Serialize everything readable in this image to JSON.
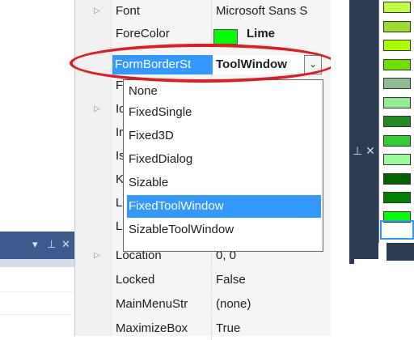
{
  "left_panel": {
    "titlebar_controls": [
      "▾",
      "ᛜ",
      "✕"
    ]
  },
  "properties": [
    {
      "name": "Font",
      "value": "Microsoft Sans S",
      "expandable": true
    },
    {
      "name": "ForeColor",
      "value": "Lime",
      "bold": true,
      "swatch": "#00ff00"
    },
    {
      "name": "FormBorderSt",
      "value": "ToolWindow",
      "selected": true
    },
    {
      "name": "F",
      "value": ""
    },
    {
      "name": "Ic",
      "value": "",
      "expandable": true
    },
    {
      "name": "Ir",
      "value": ""
    },
    {
      "name": "Is",
      "value": ""
    },
    {
      "name": "K",
      "value": ""
    },
    {
      "name": "L",
      "value": ""
    },
    {
      "name": "L",
      "value": ""
    },
    {
      "name": "Location",
      "value": "0, 0",
      "expandable": true
    },
    {
      "name": "Locked",
      "value": "False"
    },
    {
      "name": "MainMenuStr",
      "value": "(none)"
    },
    {
      "name": "MaximizeBox",
      "value": "True"
    }
  ],
  "combo": {
    "button_glyph": "⌄"
  },
  "dropdown": {
    "options": [
      "None",
      "FixedSingle",
      "Fixed3D",
      "FixedDialog",
      "Sizable",
      "FixedToolWindow",
      "SizableToolWindow"
    ],
    "selected_index": 5
  },
  "right_panel": {
    "dark_label": "⊥ ✕",
    "swatches": [
      "#bfff3f",
      "#9bdc2e",
      "#aaff00",
      "#6ee000",
      "#8fbc8f",
      "#90ee90",
      "#228b22",
      "#32cd32",
      "#98fb98",
      "#006400",
      "#008000",
      "#00ff00"
    ],
    "selected_swatch": 11
  },
  "colors": {
    "selection": "#3399ff",
    "highlight_ellipse": "#e01b24",
    "lime": "#00ff00"
  }
}
